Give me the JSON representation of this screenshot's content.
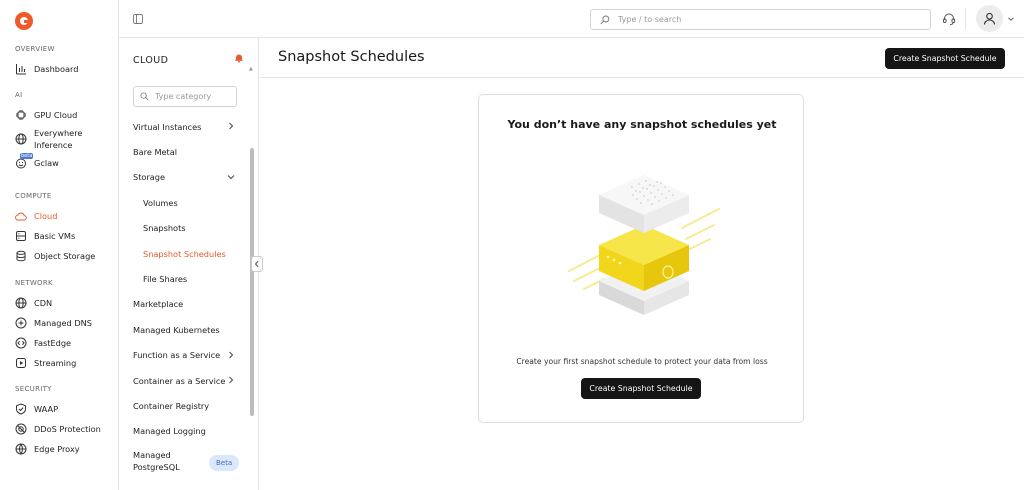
{
  "topbar": {
    "search_placeholder": "Type / to search"
  },
  "leftnav": {
    "sections": [
      {
        "title": "OVERVIEW",
        "items": [
          {
            "label": "Dashboard",
            "icon": "bar-chart-icon"
          }
        ]
      },
      {
        "title": "AI",
        "items": [
          {
            "label": "GPU Cloud",
            "icon": "chip-icon"
          },
          {
            "label": "Everywhere Inference",
            "icon": "globe-icon"
          },
          {
            "label": "Gclaw",
            "icon": "smiley-icon",
            "badge": "beta"
          }
        ]
      },
      {
        "title": "COMPUTE",
        "items": [
          {
            "label": "Cloud",
            "icon": "cloud-icon",
            "active": true
          },
          {
            "label": "Basic VMs",
            "icon": "server-icon"
          },
          {
            "label": "Object Storage",
            "icon": "database-icon"
          }
        ]
      },
      {
        "title": "NETWORK",
        "items": [
          {
            "label": "CDN",
            "icon": "globe-icon"
          },
          {
            "label": "Managed DNS",
            "icon": "dns-icon"
          },
          {
            "label": "FastEdge",
            "icon": "code-icon"
          },
          {
            "label": "Streaming",
            "icon": "play-icon"
          }
        ]
      },
      {
        "title": "SECURITY",
        "items": [
          {
            "label": "WAAP",
            "icon": "shield-check-icon"
          },
          {
            "label": "DDoS Protection",
            "icon": "ddos-icon"
          },
          {
            "label": "Edge Proxy",
            "icon": "network-icon"
          }
        ]
      }
    ]
  },
  "subnav": {
    "title": "CLOUD",
    "search_placeholder": "Type category",
    "items": [
      {
        "label": "Virtual Instances",
        "chevron": "right"
      },
      {
        "label": "Bare Metal"
      },
      {
        "label": "Storage",
        "chevron": "down"
      },
      {
        "label": "Volumes",
        "child": true
      },
      {
        "label": "Snapshots",
        "child": true
      },
      {
        "label": "Snapshot Schedules",
        "child": true,
        "active": true
      },
      {
        "label": "File Shares",
        "child": true
      },
      {
        "label": "Marketplace"
      },
      {
        "label": "Managed Kubernetes"
      },
      {
        "label": "Function as a Service",
        "chevron": "right"
      },
      {
        "label": "Container as a Service",
        "chevron": "right"
      },
      {
        "label": "Container Registry"
      },
      {
        "label": "Managed Logging"
      },
      {
        "label": "Managed PostgreSQL",
        "badge": "Beta"
      }
    ]
  },
  "main": {
    "title": "Snapshot Schedules",
    "create_button": "Create Snapshot Schedule",
    "empty": {
      "title": "You don’t have any snapshot schedules yet",
      "description": "Create your first snapshot schedule to protect your data from loss",
      "button": "Create Snapshot Schedule"
    }
  },
  "colors": {
    "accent": "#e55a2b",
    "brand": "#f05a28",
    "button_dark": "#151515",
    "illustration_yellow": "#f2d61b"
  }
}
